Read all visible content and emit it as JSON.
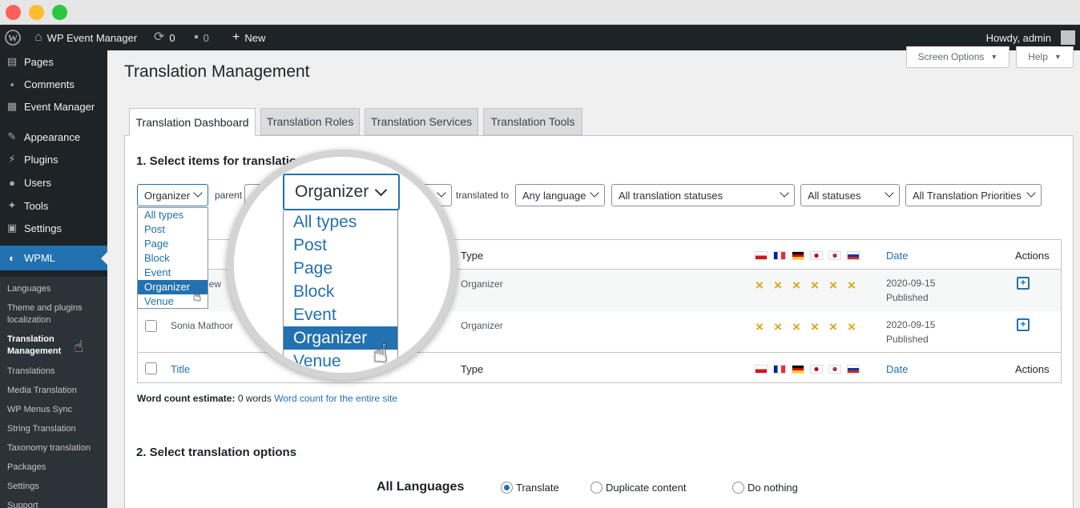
{
  "admin_bar": {
    "site_name": "WP Event Manager",
    "updates_count": "0",
    "comments_count": "0",
    "new_label": "New",
    "greeting": "Howdy, admin"
  },
  "sidebar": {
    "items": [
      {
        "label": "Pages",
        "icon": "pages-icon"
      },
      {
        "label": "Comments",
        "icon": "comments-icon"
      },
      {
        "label": "Event Manager",
        "icon": "calendar-icon"
      },
      {
        "label": "Appearance",
        "icon": "brush-icon"
      },
      {
        "label": "Plugins",
        "icon": "plugin-icon"
      },
      {
        "label": "Users",
        "icon": "user-icon"
      },
      {
        "label": "Tools",
        "icon": "wrench-icon"
      },
      {
        "label": "Settings",
        "icon": "settings-icon"
      },
      {
        "label": "WPML",
        "icon": "wpml-icon"
      }
    ],
    "submenu": [
      "Languages",
      "Theme and plugins localization",
      "Translation Management",
      "Translations",
      "Media Translation",
      "WP Menus Sync",
      "String Translation",
      "Taxonomy translation",
      "Packages",
      "Settings",
      "Support"
    ]
  },
  "screen_options": {
    "screen_label": "Screen Options",
    "help_label": "Help"
  },
  "page": {
    "title": "Translation Management",
    "tabs": [
      "Translation Dashboard",
      "Translation Roles",
      "Translation Services",
      "Translation Tools"
    ]
  },
  "section1": {
    "title": "1. Select items for translation",
    "type_filter": "Organizer",
    "parent_label": "parent",
    "translated_to_label": "translated to",
    "language_filter": "Any language",
    "translation_status_filter": "All translation statuses",
    "status_filter": "All statuses",
    "priority_filter": "All Translation Priorities",
    "type_options": [
      "All types",
      "Post",
      "Page",
      "Block",
      "Event",
      "Organizer",
      "Venue"
    ],
    "selected_type": "Organizer"
  },
  "table": {
    "headers": {
      "title": "Title",
      "type": "Type",
      "date": "Date",
      "actions": "Actions"
    },
    "rows": [
      {
        "title": "hew",
        "type": "Organizer",
        "date": "2020-09-15",
        "status": "Published"
      },
      {
        "title": "Sonia Mathoor",
        "type": "Organizer",
        "date": "2020-09-15",
        "status": "Published"
      }
    ],
    "footer": {
      "title": "Title",
      "type": "Type",
      "date": "Date",
      "actions": "Actions"
    },
    "status_mark": "×"
  },
  "word_count": {
    "label": "Word count estimate:",
    "value": "0 words",
    "link": "Word count for the entire site"
  },
  "section2": {
    "title": "2. Select translation options",
    "all_languages": "All Languages",
    "options": [
      "Translate",
      "Duplicate content",
      "Do nothing"
    ],
    "selected": "Translate"
  },
  "colors": {
    "accent": "#2271b1",
    "admin_dark": "#1d2327",
    "status_warning": "#dba617"
  }
}
